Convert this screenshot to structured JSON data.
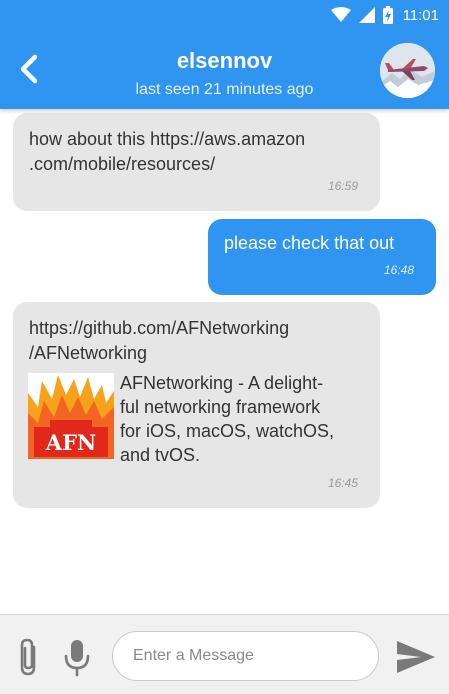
{
  "status_bar": {
    "time": "11:01",
    "icons": [
      "wifi-icon",
      "cell-signal-icon",
      "battery-charging-icon"
    ]
  },
  "header": {
    "back_icon": "chevron-left-icon",
    "contact_name": "elsennov",
    "last_seen": "last seen 21 minutes ago",
    "avatar_icon": "airplane-avatar"
  },
  "messages": [
    {
      "direction": "incoming",
      "lines": [
        "how about this https://aws.amazon",
        ".com/mobile/resources/"
      ],
      "time": "16:59"
    },
    {
      "direction": "outgoing",
      "lines": [
        "please check that out"
      ],
      "time": "16:48"
    },
    {
      "direction": "incoming",
      "lines": [
        "https://github.com/AFNetworking",
        "/AFNetworking"
      ],
      "preview": {
        "thumb_text": "AFN",
        "description_lines": [
          "AFNetworking - A delight-",
          "ful networking framework",
          "for iOS, macOS, watchOS,",
          "and tvOS."
        ]
      },
      "time": "16:45"
    }
  ],
  "composer": {
    "attach_icon": "paperclip-icon",
    "mic_icon": "microphone-icon",
    "placeholder": "Enter a Message",
    "value": "",
    "send_icon": "send-icon"
  },
  "colors": {
    "primary": "#2f95f0",
    "incoming_bubble": "#e6e6e6",
    "outgoing_text": "#ffffff",
    "afn_orange": "#f26522",
    "afn_red": "#e1291b"
  }
}
